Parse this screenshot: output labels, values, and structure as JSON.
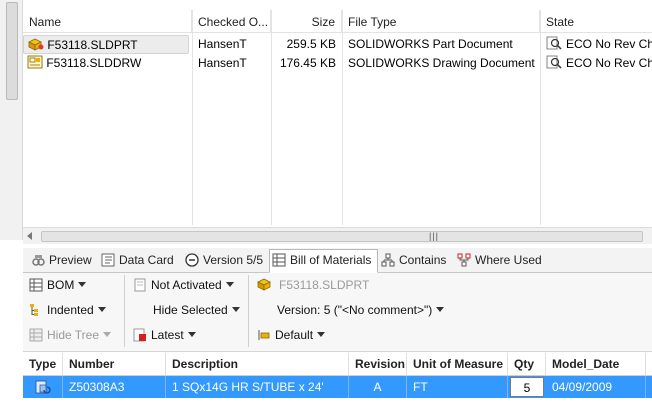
{
  "file_list": {
    "columns": [
      "Name",
      "Checked O...",
      "Size",
      "File Type",
      "State"
    ],
    "rows": [
      {
        "name": "F53118.SLDPRT",
        "checked_out": "HansenT",
        "size": "259.5 KB",
        "file_type": "SOLIDWORKS Part Document",
        "state": "ECO No Rev Cha",
        "icon": "part-file-icon"
      },
      {
        "name": "F53118.SLDDRW",
        "checked_out": "HansenT",
        "size": "176.45 KB",
        "file_type": "SOLIDWORKS Drawing Document",
        "state": "ECO No Rev Cha",
        "icon": "drawing-file-icon"
      }
    ]
  },
  "tabs": [
    {
      "label": "Preview",
      "icon": "preview-icon",
      "active": false
    },
    {
      "label": "Data Card",
      "icon": "data-card-icon",
      "active": false
    },
    {
      "label": "Version 5/5",
      "icon": "version-icon",
      "active": false
    },
    {
      "label": "Bill of Materials",
      "icon": "bom-icon",
      "active": true
    },
    {
      "label": "Contains",
      "icon": "contains-icon",
      "active": false
    },
    {
      "label": "Where Used",
      "icon": "where-used-icon",
      "active": false
    }
  ],
  "toolbar": {
    "bom": "BOM",
    "indented": "Indented",
    "hide_tree": "Hide Tree",
    "not_activated": "Not Activated",
    "hide_selected": "Hide Selected",
    "latest": "Latest",
    "file_name": "F53118.SLDPRT",
    "version": "Version: 5 (\"<No comment>\")",
    "default": "Default"
  },
  "bom": {
    "columns": [
      "Type",
      "Number",
      "Description",
      "Revision",
      "Unit of Measure",
      "Qty",
      "Model_Date"
    ],
    "rows": [
      {
        "number": "Z50308A3",
        "description": "1 SQx14G HR S/TUBE x 24'",
        "revision": "A",
        "unit": "FT",
        "qty": "5",
        "model_date": "04/09/2009"
      }
    ]
  },
  "colors": {
    "selection": "#3399ff",
    "accent_red": "#d02020"
  }
}
